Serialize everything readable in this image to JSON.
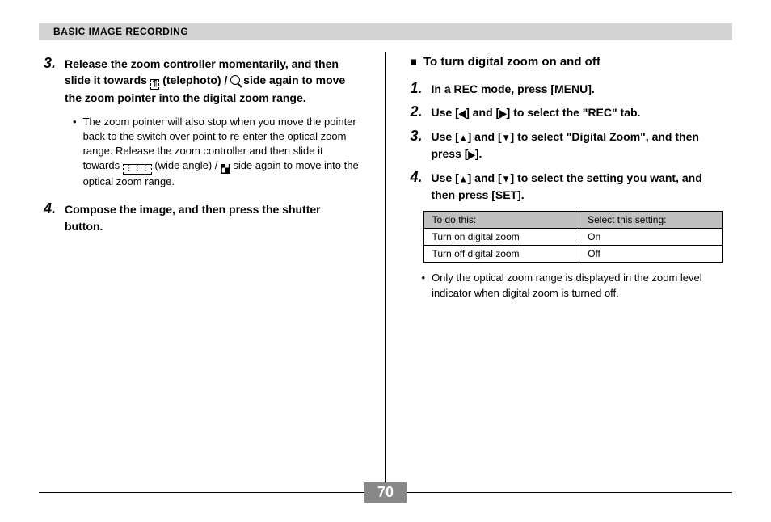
{
  "header": "BASIC IMAGE RECORDING",
  "pageNumber": "70",
  "left": {
    "step3": {
      "num": "3.",
      "pre": "Release the zoom controller momentarily, and then slide it towards ",
      "tele": "(telephoto) / ",
      "post": " side again to move the zoom pointer into the digital zoom range."
    },
    "bullet": {
      "a": "The zoom pointer will also stop when you move the pointer back to the switch over point to re-enter the optical zoom range. Release the zoom controller and then slide it towards ",
      "wide": " (wide angle) / ",
      "b": " side again to move into the optical zoom range."
    },
    "step4": {
      "num": "4.",
      "text": "Compose the image, and then press the shutter button."
    }
  },
  "right": {
    "heading": "To turn digital zoom on and off",
    "s1": {
      "num": "1.",
      "text": "In a REC mode, press [MENU]."
    },
    "s2": {
      "num": "2.",
      "a": "Use [",
      "b": "] and [",
      "c": "] to select the \"REC\" tab."
    },
    "s3": {
      "num": "3.",
      "a": "Use [",
      "b": "] and [",
      "c": "] to select \"Digital Zoom\", and then press [",
      "d": "]."
    },
    "s4": {
      "num": "4.",
      "a": "Use [",
      "b": "] and [",
      "c": "] to select the setting you want, and then press [SET]."
    },
    "table": {
      "h1": "To do this:",
      "h2": "Select this setting:",
      "r1c1": "Turn on digital zoom",
      "r1c2": "On",
      "r2c1": "Turn off digital zoom",
      "r2c2": "Off"
    },
    "note": "Only the optical zoom range is displayed in the zoom level indicator when digital zoom is turned off."
  }
}
